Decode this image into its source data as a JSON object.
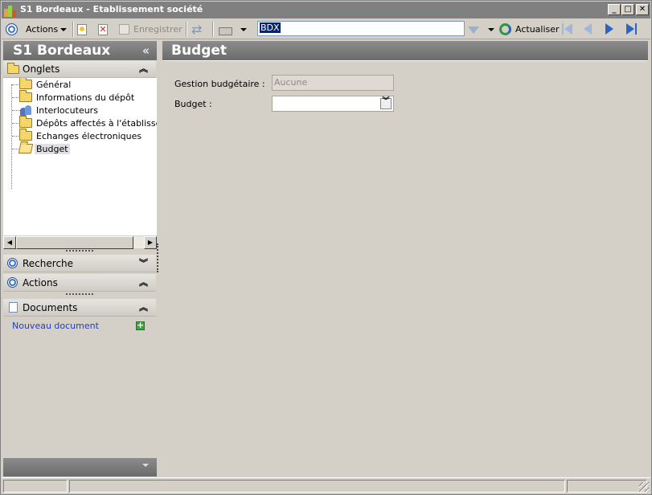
{
  "window": {
    "title": "S1 Bordeaux - Etablissement société",
    "controls": {
      "minimize": "_",
      "maximize": "□",
      "close": "✕"
    }
  },
  "toolbar": {
    "actions_label": "Actions",
    "save_label": "Enregistrer",
    "search_value": "BDX",
    "refresh_label": "Actualiser"
  },
  "left_panel": {
    "title": "S1 Bordeaux",
    "collapse_glyph": "«",
    "tabs_section": {
      "label": "Onglets",
      "items": [
        {
          "label": "Général",
          "icon": "folder-icon"
        },
        {
          "label": "Informations du dépôt",
          "icon": "folder-icon"
        },
        {
          "label": "Interlocuteurs",
          "icon": "people-icon"
        },
        {
          "label": "Dépôts affectés à l'établisseme",
          "icon": "folder-icon"
        },
        {
          "label": "Echanges électroniques",
          "icon": "folder-icon"
        },
        {
          "label": "Budget",
          "icon": "open-folder-icon",
          "selected": true
        }
      ]
    },
    "search_section": {
      "label": "Recherche"
    },
    "actions_section": {
      "label": "Actions"
    },
    "documents_section": {
      "label": "Documents",
      "new_document": "Nouveau document"
    }
  },
  "main": {
    "title": "Budget",
    "fields": {
      "budget_management_label": "Gestion budgétaire :",
      "budget_management_value": "Aucune",
      "budget_label": "Budget :",
      "budget_value": ""
    }
  },
  "colors": {
    "header_gray": "#7b7b7b",
    "accent_blue": "#3b6fc5",
    "link_blue": "#1f3fbf"
  }
}
